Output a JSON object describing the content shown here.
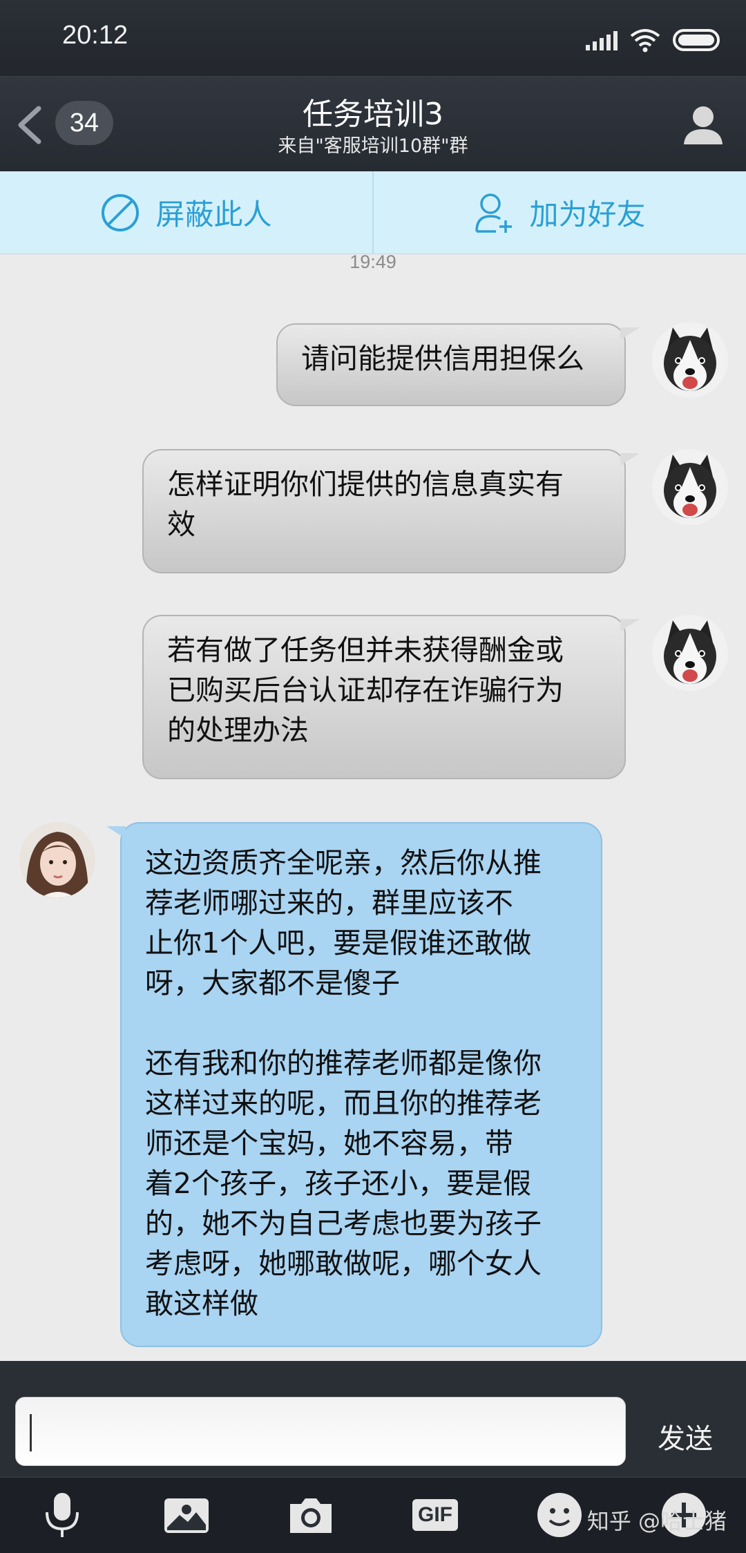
{
  "status_bar": {
    "time": "20:12"
  },
  "header": {
    "unread_count": "34",
    "title": "任务培训3",
    "subtitle": "来自\"客服培训10群\"群"
  },
  "actions": {
    "block_label": "屏蔽此人",
    "add_friend_label": "加为好友"
  },
  "chat": {
    "timestamp": "19:49",
    "messages": [
      {
        "direction": "outgoing",
        "lines": [
          "请问能提供信用担保么"
        ]
      },
      {
        "direction": "outgoing",
        "lines": [
          "怎样证明你们提供的信息真实有",
          "效"
        ]
      },
      {
        "direction": "outgoing",
        "lines": [
          "若有做了任务但并未获得酬金或",
          "已购买后台认证却存在诈骗行为",
          "的处理办法"
        ]
      },
      {
        "direction": "incoming",
        "lines": [
          "这边资质齐全呢亲，然后你从推",
          "荐老师哪过来的，群里应该不",
          "止你1个人吧，要是假谁还敢做",
          "呀，大家都不是傻子",
          "",
          "还有我和你的推荐老师都是像你",
          "这样过来的呢，而且你的推荐老",
          "师还是个宝妈，她不容易，带",
          "着2个孩子，孩子还小，要是假",
          "的，她不为自己考虑也要为孩子",
          "考虑呀，她哪敢做呢，哪个女人",
          "敢这样做"
        ]
      }
    ]
  },
  "composer": {
    "input_value": "",
    "send_label": "发送"
  },
  "toolbar": {
    "icons": [
      "microphone-icon",
      "image-icon",
      "camera-icon",
      "gif-icon",
      "emoji-icon",
      "plus-icon"
    ],
    "gif_label": "GIF"
  },
  "watermark": "知乎 @哈士猪",
  "colors": {
    "header_bg": "#2b2f36",
    "action_bar_bg": "#d4f1fb",
    "action_text": "#2b9fd4",
    "incoming_bubble": "#a9d4f2",
    "outgoing_bubble": "#d6d6d6",
    "chat_bg": "#ebebeb"
  }
}
